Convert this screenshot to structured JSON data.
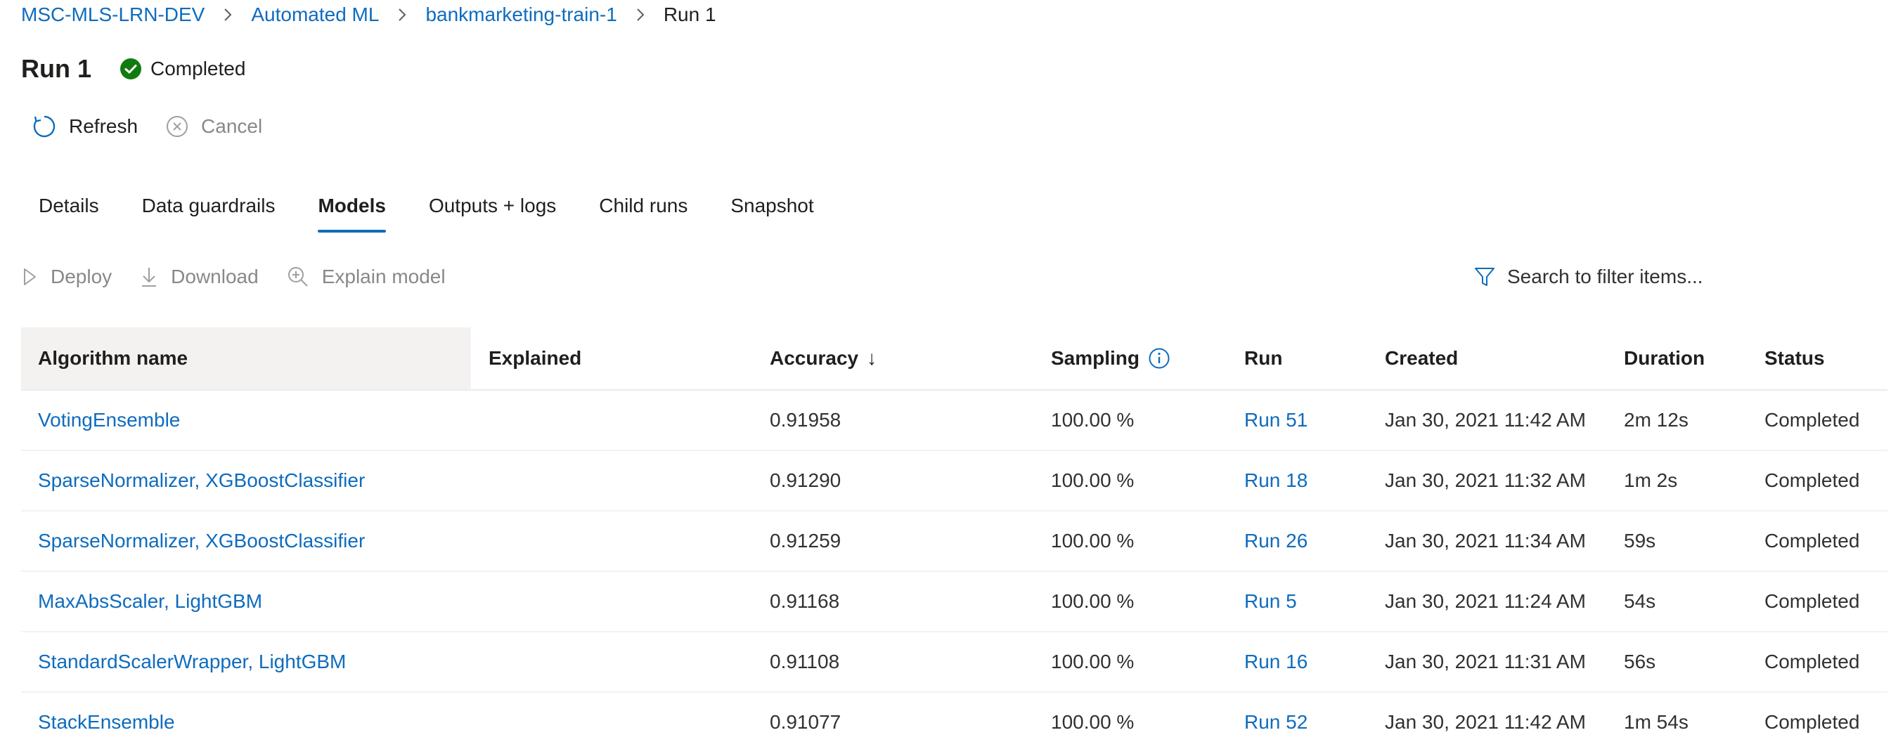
{
  "breadcrumb": {
    "items": [
      "MSC-MLS-LRN-DEV",
      "Automated ML",
      "bankmarketing-train-1"
    ],
    "current": "Run 1"
  },
  "header": {
    "title": "Run 1",
    "status": "Completed",
    "status_color": "#107c10"
  },
  "commands": {
    "refresh": "Refresh",
    "cancel": "Cancel"
  },
  "tabs": [
    {
      "label": "Details"
    },
    {
      "label": "Data guardrails"
    },
    {
      "label": "Models",
      "active": true
    },
    {
      "label": "Outputs + logs"
    },
    {
      "label": "Child runs"
    },
    {
      "label": "Snapshot"
    }
  ],
  "toolbar": {
    "deploy": "Deploy",
    "download": "Download",
    "explain": "Explain model",
    "filter_placeholder": "Search to filter items..."
  },
  "table": {
    "columns": {
      "algorithm": "Algorithm name",
      "explained": "Explained",
      "accuracy": "Accuracy",
      "accuracy_sort": "↓",
      "sampling": "Sampling",
      "run": "Run",
      "created": "Created",
      "duration": "Duration",
      "status": "Status"
    },
    "rows": [
      {
        "algorithm": "VotingEnsemble",
        "explained": "",
        "accuracy": "0.91958",
        "sampling": "100.00 %",
        "run": "Run 51",
        "created": "Jan 30, 2021 11:42 AM",
        "duration": "2m 12s",
        "status": "Completed"
      },
      {
        "algorithm": "SparseNormalizer, XGBoostClassifier",
        "explained": "",
        "accuracy": "0.91290",
        "sampling": "100.00 %",
        "run": "Run 18",
        "created": "Jan 30, 2021 11:32 AM",
        "duration": "1m 2s",
        "status": "Completed"
      },
      {
        "algorithm": "SparseNormalizer, XGBoostClassifier",
        "explained": "",
        "accuracy": "0.91259",
        "sampling": "100.00 %",
        "run": "Run 26",
        "created": "Jan 30, 2021 11:34 AM",
        "duration": "59s",
        "status": "Completed"
      },
      {
        "algorithm": "MaxAbsScaler, LightGBM",
        "explained": "",
        "accuracy": "0.91168",
        "sampling": "100.00 %",
        "run": "Run 5",
        "created": "Jan 30, 2021 11:24 AM",
        "duration": "54s",
        "status": "Completed"
      },
      {
        "algorithm": "StandardScalerWrapper, LightGBM",
        "explained": "",
        "accuracy": "0.91108",
        "sampling": "100.00 %",
        "run": "Run 16",
        "created": "Jan 30, 2021 11:31 AM",
        "duration": "56s",
        "status": "Completed"
      },
      {
        "algorithm": "StackEnsemble",
        "explained": "",
        "accuracy": "0.91077",
        "sampling": "100.00 %",
        "run": "Run 52",
        "created": "Jan 30, 2021 11:42 AM",
        "duration": "1m 54s",
        "status": "Completed"
      }
    ]
  },
  "colors": {
    "accent": "#0f6cbd",
    "disabled": "#8a8886"
  }
}
